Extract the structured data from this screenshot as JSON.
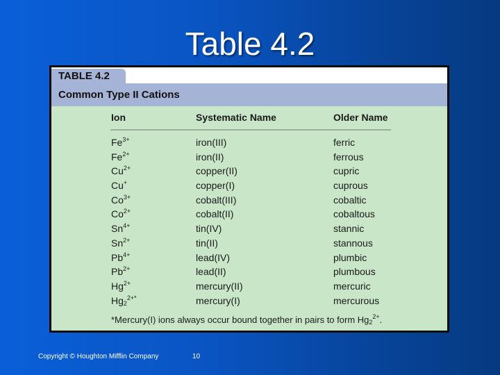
{
  "slide": {
    "title": "Table 4.2",
    "copyright": "Copyright © Houghton Mifflin Company",
    "page_number": "10"
  },
  "table": {
    "tab_label": "TABLE 4.2",
    "caption": "Common Type II Cations",
    "headers": [
      "Ion",
      "Systematic Name",
      "Older Name"
    ],
    "rows": [
      {
        "ion_base": "Fe",
        "ion_sub": "",
        "ion_charge": "3+",
        "systematic": "iron(III)",
        "older": "ferric"
      },
      {
        "ion_base": "Fe",
        "ion_sub": "",
        "ion_charge": "2+",
        "systematic": "iron(II)",
        "older": "ferrous"
      },
      {
        "ion_base": "Cu",
        "ion_sub": "",
        "ion_charge": "2+",
        "systematic": "copper(II)",
        "older": "cupric"
      },
      {
        "ion_base": "Cu",
        "ion_sub": "",
        "ion_charge": "+",
        "systematic": "copper(I)",
        "older": "cuprous"
      },
      {
        "ion_base": "Co",
        "ion_sub": "",
        "ion_charge": "3+",
        "systematic": "cobalt(III)",
        "older": "cobaltic"
      },
      {
        "ion_base": "Co",
        "ion_sub": "",
        "ion_charge": "2+",
        "systematic": "cobalt(II)",
        "older": "cobaltous"
      },
      {
        "ion_base": "Sn",
        "ion_sub": "",
        "ion_charge": "4+",
        "systematic": "tin(IV)",
        "older": "stannic"
      },
      {
        "ion_base": "Sn",
        "ion_sub": "",
        "ion_charge": "2+",
        "systematic": "tin(II)",
        "older": "stannous"
      },
      {
        "ion_base": "Pb",
        "ion_sub": "",
        "ion_charge": "4+",
        "systematic": "lead(IV)",
        "older": "plumbic"
      },
      {
        "ion_base": "Pb",
        "ion_sub": "",
        "ion_charge": "2+",
        "systematic": "lead(II)",
        "older": "plumbous"
      },
      {
        "ion_base": "Hg",
        "ion_sub": "",
        "ion_charge": "2+",
        "systematic": "mercury(II)",
        "older": "mercuric"
      },
      {
        "ion_base": "Hg",
        "ion_sub": "2",
        "ion_charge": "2+*",
        "systematic": "mercury(I)",
        "older": "mercurous"
      }
    ],
    "footnote_text": "*Mercury(I) ions always occur bound together in pairs to form Hg",
    "footnote_sub": "2",
    "footnote_sup": "2+",
    "footnote_end": "."
  },
  "colors": {
    "tab_bar": "#a5b4d6",
    "table_body": "#c9e6c8",
    "background_blue": "#0a55c4"
  }
}
